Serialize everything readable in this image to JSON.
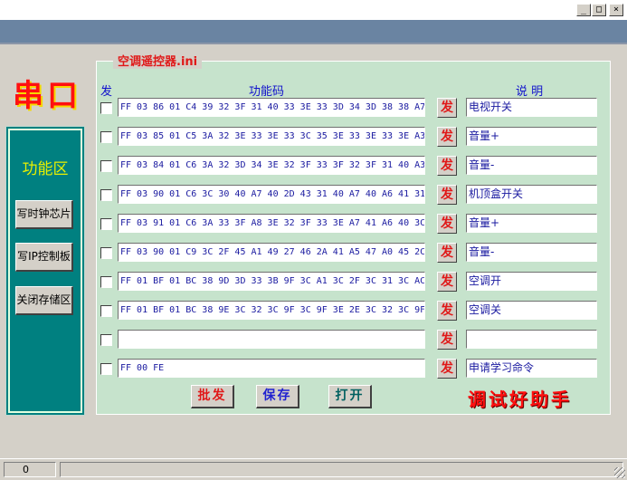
{
  "window": {
    "buttons": {
      "minimize": "_",
      "maximize": "□",
      "close": "×"
    }
  },
  "logo": "串口",
  "left_panel": {
    "title": "功能区",
    "buttons": [
      "写时钟芯片",
      "写IP控制板",
      "关闭存储区"
    ]
  },
  "main": {
    "group_title": "空调遥控器.ini",
    "header_send": "发",
    "header_code": "功能码",
    "header_desc": "说 明",
    "send_label": "发",
    "rows": [
      {
        "code": "FF 03 86 01 C4 39 32 3F 31 40 33 3E 33 3D 34 3D 38 38 A7",
        "desc": "电视开关"
      },
      {
        "code": "FF 03 85 01 C5 3A 32 3E 33 3E 33 3C 35 3E 33 3E 33 3E A3",
        "desc": "音量+"
      },
      {
        "code": "FF 03 84 01 C6 3A 32 3D 34 3E 32 3F 33 3F 32 3F 31 40 A3",
        "desc": "音量-"
      },
      {
        "code": "FF 03 90 01 C6 3C 30 40 A7 40 2D 43 31 40 A7 40 A6 41 31",
        "desc": "机顶盒开关"
      },
      {
        "code": "FF 03 91 01 C6 3A 33 3F A8 3E 32 3F 33 3E A7 41 A6 40 3C",
        "desc": "音量+"
      },
      {
        "code": "FF 03 90 01 C9 3C 2F 45 A1 49 27 46 2A 41 A5 47 A0 45 2C",
        "desc": "音量-"
      },
      {
        "code": "FF 01 BF 01 BC 38 9D 3D 33 3B 9F 3C A1 3C 2F 3C 31 3C AC",
        "desc": "空调开"
      },
      {
        "code": "FF 01 BF 01 BC 38 9E 3C 32 3C 9F 3C 9F 3E 2E 3C 32 3C 9F",
        "desc": "空调关"
      },
      {
        "code": "",
        "desc": ""
      },
      {
        "code": "FF 00 FE",
        "desc": "申请学习命令"
      }
    ],
    "actions": {
      "batch": "批发",
      "save": "保存",
      "open": "打开"
    },
    "brand": "调试好助手"
  },
  "status": {
    "value": "0"
  },
  "colors": {
    "panel_green": "#c6e3cc",
    "teal": "#008080",
    "accent_red": "#e01818",
    "text_blue": "#1a1aa0",
    "band": "#6a84a2"
  }
}
